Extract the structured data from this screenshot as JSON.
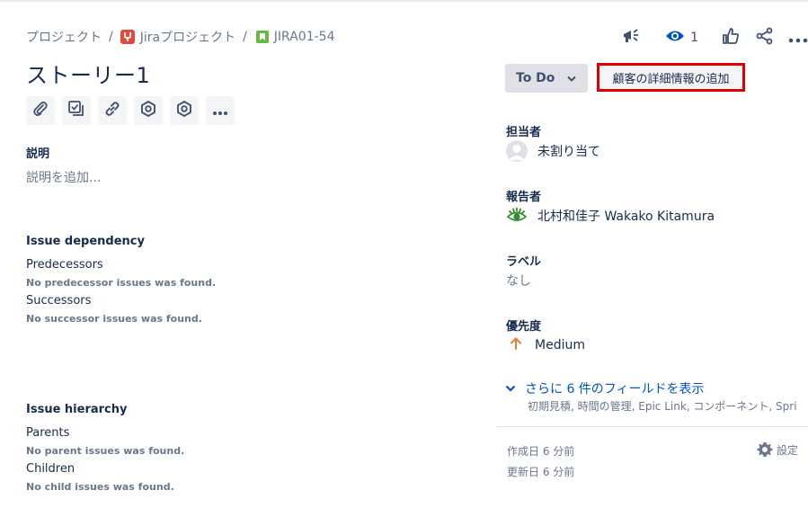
{
  "breadcrumb": {
    "items": [
      "プロジェクト",
      "Jiraプロジェクト",
      "JIRA01-54"
    ],
    "separator": "/"
  },
  "header": {
    "watch_count": "1",
    "icons": [
      "megaphone-icon",
      "eye-icon",
      "thumbs-up-icon",
      "share-icon",
      "more-icon"
    ]
  },
  "issue": {
    "title": "ストーリー1",
    "toolbar_icons": [
      "attachment-icon",
      "checklist-icon",
      "link-icon",
      "hexagon-icon",
      "hexagon-icon",
      "more-icon"
    ]
  },
  "description": {
    "label": "説明",
    "placeholder": "説明を追加..."
  },
  "dependency": {
    "title": "Issue dependency",
    "predecessors_label": "Predecessors",
    "predecessors_empty": "No predecessor issues was found.",
    "successors_label": "Successors",
    "successors_empty": "No successor issues was found."
  },
  "hierarchy": {
    "title": "Issue hierarchy",
    "parents_label": "Parents",
    "parents_empty": "No parent issues was found.",
    "children_label": "Children",
    "children_empty": "No child issues was found."
  },
  "status": {
    "label": "To Do",
    "add_button": "顧客の詳細情報の追加"
  },
  "fields": {
    "assignee_label": "担当者",
    "assignee_value": "未割り当て",
    "reporter_label": "報告者",
    "reporter_value": "北村和佳子 Wakako Kitamura",
    "labels_label": "ラベル",
    "labels_value": "なし",
    "priority_label": "優先度",
    "priority_value": "Medium"
  },
  "more_fields": {
    "label": "さらに 6 件のフィールドを表示",
    "sub": "初期見積, 時間の管理, Epic Link, コンポーネント, Sprin..."
  },
  "footer": {
    "created": "作成日 6 分前",
    "updated": "更新日 6 分前",
    "settings": "設定"
  },
  "colors": {
    "accent": "#0052cc",
    "project_icon": "#e5493a",
    "story_icon": "#63ba3c",
    "priority_medium": "#e2812d",
    "highlight": "#e00000"
  }
}
